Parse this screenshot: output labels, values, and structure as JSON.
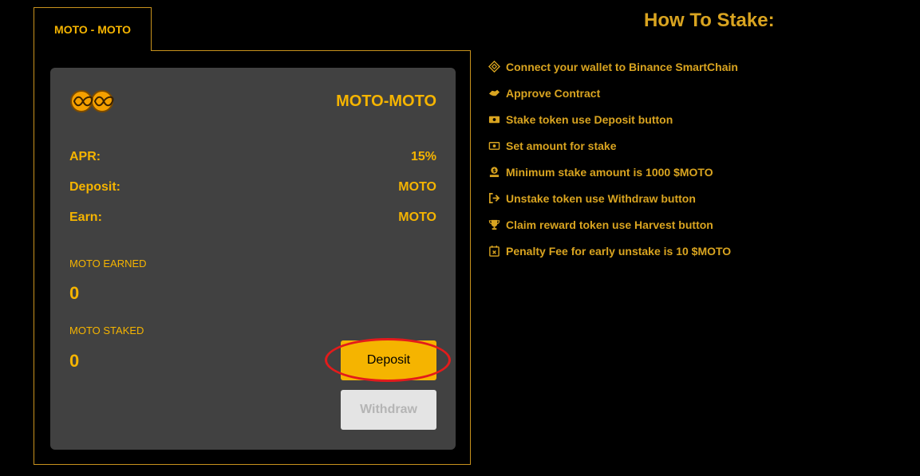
{
  "pool_tab": {
    "label": "MOTO - MOTO"
  },
  "card": {
    "title": "MOTO-MOTO",
    "apr_label": "APR:",
    "apr_value": "15%",
    "deposit_label": "Deposit:",
    "deposit_value": "MOTO",
    "earn_label": "Earn:",
    "earn_value": "MOTO",
    "earned_label": "MOTO EARNED",
    "earned_value": "0",
    "staked_label": "MOTO STAKED",
    "staked_value": "0",
    "deposit_button": "Deposit",
    "withdraw_button": "Withdraw"
  },
  "howto": {
    "title": "How To Stake:",
    "steps": [
      {
        "icon": "binance-icon",
        "text": "Connect your wallet to Binance SmartChain"
      },
      {
        "icon": "handshake-icon",
        "text": "Approve Contract"
      },
      {
        "icon": "money-icon",
        "text": "Stake token use Deposit button"
      },
      {
        "icon": "money-bill-icon",
        "text": "Set amount for stake"
      },
      {
        "icon": "coin-hand-icon",
        "text": "Minimum stake amount is 1000 $MOTO"
      },
      {
        "icon": "sign-out-icon",
        "text": "Unstake token use Withdraw button"
      },
      {
        "icon": "trophy-icon",
        "text": "Claim reward token use Harvest button"
      },
      {
        "icon": "calendar-x-icon",
        "text": "Penalty Fee for early unstake is 10 $MOTO"
      }
    ]
  },
  "colors": {
    "accent": "#f5b400",
    "text_gold": "#d9a420",
    "card_bg": "#414141",
    "highlight": "#e31b1b"
  }
}
